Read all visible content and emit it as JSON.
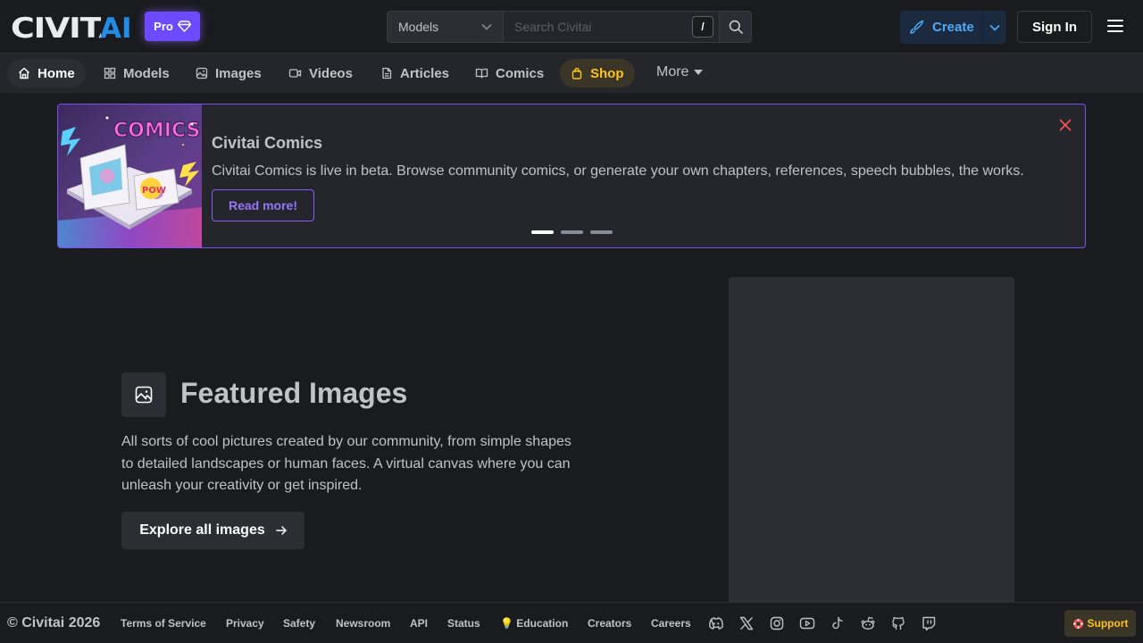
{
  "header": {
    "logo_text": "CIVITAI",
    "pro_label": "Pro",
    "search": {
      "select_value": "Models",
      "placeholder": "Search Civitai",
      "shortcut": "/"
    },
    "create_label": "Create",
    "signin_label": "Sign In"
  },
  "nav": {
    "items": [
      {
        "label": "Home",
        "icon": "home-icon"
      },
      {
        "label": "Models",
        "icon": "grid-icon"
      },
      {
        "label": "Images",
        "icon": "photo-icon"
      },
      {
        "label": "Videos",
        "icon": "video-icon"
      },
      {
        "label": "Articles",
        "icon": "file-text-icon"
      },
      {
        "label": "Comics",
        "icon": "book-icon"
      },
      {
        "label": "Shop",
        "icon": "shopping-bag-icon"
      }
    ],
    "more_label": "More"
  },
  "banner": {
    "image_text": "COMICS",
    "image_badge": "POW",
    "title": "Civitai Comics",
    "text": "Civitai Comics is live in beta. Browse community comics, or generate your own chapters, references, speech bubbles, the works.",
    "button_label": "Read more!",
    "slides": 3,
    "active_slide": 1
  },
  "featured": {
    "title": "Featured Images",
    "description": "All sorts of cool pictures created by our community, from simple shapes to detailed landscapes or human faces. A virtual canvas where you can unleash your creativity or get inspired.",
    "button_label": "Explore all images"
  },
  "footer": {
    "copyright": "© Civitai 2026",
    "links": [
      "Terms of Service",
      "Privacy",
      "Safety",
      "Newsroom",
      "API",
      "Status",
      "💡 Education",
      "Creators",
      "Careers"
    ],
    "social_icons": [
      "discord-icon",
      "x-icon",
      "instagram-icon",
      "youtube-icon",
      "tiktok-icon",
      "reddit-icon",
      "github-icon",
      "twitch-icon"
    ],
    "support_label": "Support"
  },
  "colors": {
    "background": "#1a1b1e",
    "accent_violet": "#7950f2",
    "create_blue": "#4dabf7",
    "shop_yellow": "#fcc419"
  }
}
